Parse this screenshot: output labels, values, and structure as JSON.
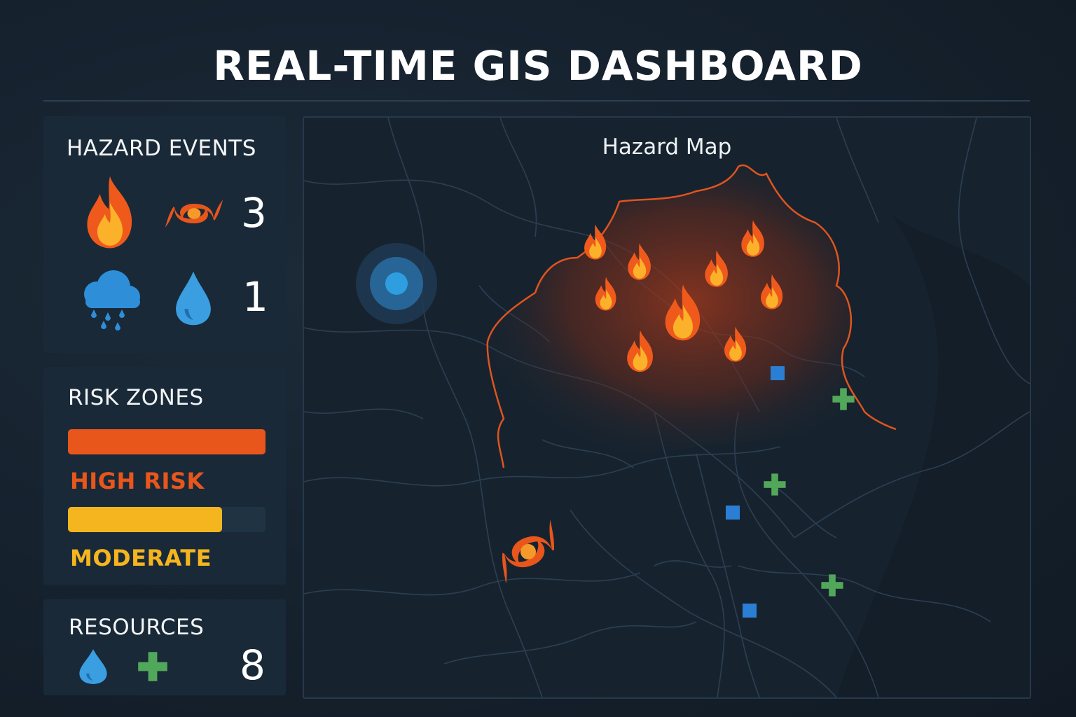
{
  "header": {
    "title": "REAL-TIME GIS DASHBOARD"
  },
  "hazard_events": {
    "title": "HAZARD EVENTS",
    "rows": [
      {
        "icons": [
          "fire-icon",
          "hurricane-icon"
        ],
        "count": "3"
      },
      {
        "icons": [
          "rain-cloud-icon",
          "water-drop-icon"
        ],
        "count": "1"
      }
    ]
  },
  "risk_zones": {
    "title": "RISK ZONES",
    "levels": [
      {
        "label": "HIGH RISK",
        "color": "#e8561c",
        "fill_percent": 100
      },
      {
        "label": "MODERATE",
        "color": "#f5b51f",
        "fill_percent": 78
      }
    ]
  },
  "resources": {
    "title": "RESOURCES",
    "icons": [
      "water-drop-icon",
      "medical-cross-icon"
    ],
    "count": "8"
  },
  "map": {
    "title": "Hazard Map",
    "markers": [
      "fire-icon",
      "hurricane-icon",
      "flood-target-icon",
      "medical-cross-icon",
      "resource-square-icon"
    ]
  },
  "colors": {
    "fire": "#f0641e",
    "hurricane": "#e8561c",
    "rain": "#2e8fd8",
    "medical": "#52a85a",
    "resource": "#2a7fd4",
    "moderate": "#f5b51f"
  }
}
